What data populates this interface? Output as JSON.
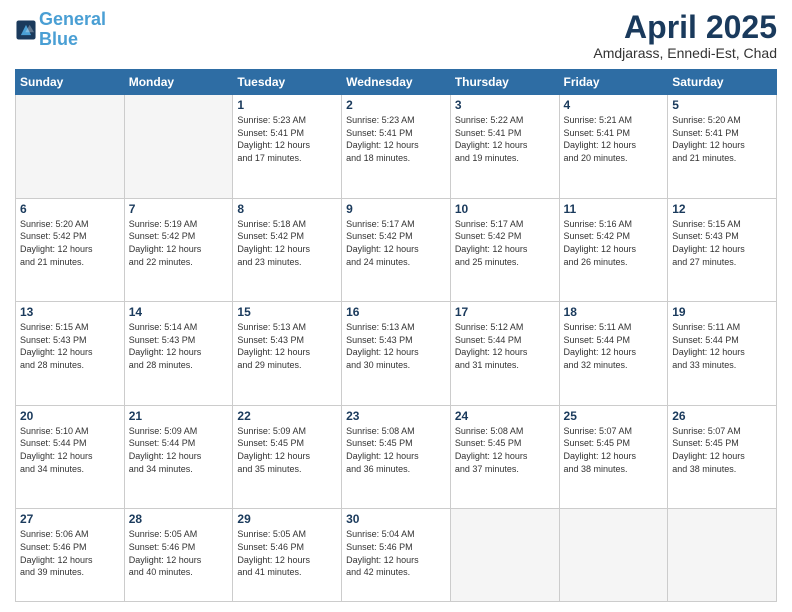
{
  "logo": {
    "line1": "General",
    "line2": "Blue"
  },
  "title": "April 2025",
  "location": "Amdjarass, Ennedi-Est, Chad",
  "days_header": [
    "Sunday",
    "Monday",
    "Tuesday",
    "Wednesday",
    "Thursday",
    "Friday",
    "Saturday"
  ],
  "weeks": [
    [
      {
        "day": "",
        "info": ""
      },
      {
        "day": "",
        "info": ""
      },
      {
        "day": "1",
        "info": "Sunrise: 5:23 AM\nSunset: 5:41 PM\nDaylight: 12 hours\nand 17 minutes."
      },
      {
        "day": "2",
        "info": "Sunrise: 5:23 AM\nSunset: 5:41 PM\nDaylight: 12 hours\nand 18 minutes."
      },
      {
        "day": "3",
        "info": "Sunrise: 5:22 AM\nSunset: 5:41 PM\nDaylight: 12 hours\nand 19 minutes."
      },
      {
        "day": "4",
        "info": "Sunrise: 5:21 AM\nSunset: 5:41 PM\nDaylight: 12 hours\nand 20 minutes."
      },
      {
        "day": "5",
        "info": "Sunrise: 5:20 AM\nSunset: 5:41 PM\nDaylight: 12 hours\nand 21 minutes."
      }
    ],
    [
      {
        "day": "6",
        "info": "Sunrise: 5:20 AM\nSunset: 5:42 PM\nDaylight: 12 hours\nand 21 minutes."
      },
      {
        "day": "7",
        "info": "Sunrise: 5:19 AM\nSunset: 5:42 PM\nDaylight: 12 hours\nand 22 minutes."
      },
      {
        "day": "8",
        "info": "Sunrise: 5:18 AM\nSunset: 5:42 PM\nDaylight: 12 hours\nand 23 minutes."
      },
      {
        "day": "9",
        "info": "Sunrise: 5:17 AM\nSunset: 5:42 PM\nDaylight: 12 hours\nand 24 minutes."
      },
      {
        "day": "10",
        "info": "Sunrise: 5:17 AM\nSunset: 5:42 PM\nDaylight: 12 hours\nand 25 minutes."
      },
      {
        "day": "11",
        "info": "Sunrise: 5:16 AM\nSunset: 5:42 PM\nDaylight: 12 hours\nand 26 minutes."
      },
      {
        "day": "12",
        "info": "Sunrise: 5:15 AM\nSunset: 5:43 PM\nDaylight: 12 hours\nand 27 minutes."
      }
    ],
    [
      {
        "day": "13",
        "info": "Sunrise: 5:15 AM\nSunset: 5:43 PM\nDaylight: 12 hours\nand 28 minutes."
      },
      {
        "day": "14",
        "info": "Sunrise: 5:14 AM\nSunset: 5:43 PM\nDaylight: 12 hours\nand 28 minutes."
      },
      {
        "day": "15",
        "info": "Sunrise: 5:13 AM\nSunset: 5:43 PM\nDaylight: 12 hours\nand 29 minutes."
      },
      {
        "day": "16",
        "info": "Sunrise: 5:13 AM\nSunset: 5:43 PM\nDaylight: 12 hours\nand 30 minutes."
      },
      {
        "day": "17",
        "info": "Sunrise: 5:12 AM\nSunset: 5:44 PM\nDaylight: 12 hours\nand 31 minutes."
      },
      {
        "day": "18",
        "info": "Sunrise: 5:11 AM\nSunset: 5:44 PM\nDaylight: 12 hours\nand 32 minutes."
      },
      {
        "day": "19",
        "info": "Sunrise: 5:11 AM\nSunset: 5:44 PM\nDaylight: 12 hours\nand 33 minutes."
      }
    ],
    [
      {
        "day": "20",
        "info": "Sunrise: 5:10 AM\nSunset: 5:44 PM\nDaylight: 12 hours\nand 34 minutes."
      },
      {
        "day": "21",
        "info": "Sunrise: 5:09 AM\nSunset: 5:44 PM\nDaylight: 12 hours\nand 34 minutes."
      },
      {
        "day": "22",
        "info": "Sunrise: 5:09 AM\nSunset: 5:45 PM\nDaylight: 12 hours\nand 35 minutes."
      },
      {
        "day": "23",
        "info": "Sunrise: 5:08 AM\nSunset: 5:45 PM\nDaylight: 12 hours\nand 36 minutes."
      },
      {
        "day": "24",
        "info": "Sunrise: 5:08 AM\nSunset: 5:45 PM\nDaylight: 12 hours\nand 37 minutes."
      },
      {
        "day": "25",
        "info": "Sunrise: 5:07 AM\nSunset: 5:45 PM\nDaylight: 12 hours\nand 38 minutes."
      },
      {
        "day": "26",
        "info": "Sunrise: 5:07 AM\nSunset: 5:45 PM\nDaylight: 12 hours\nand 38 minutes."
      }
    ],
    [
      {
        "day": "27",
        "info": "Sunrise: 5:06 AM\nSunset: 5:46 PM\nDaylight: 12 hours\nand 39 minutes."
      },
      {
        "day": "28",
        "info": "Sunrise: 5:05 AM\nSunset: 5:46 PM\nDaylight: 12 hours\nand 40 minutes."
      },
      {
        "day": "29",
        "info": "Sunrise: 5:05 AM\nSunset: 5:46 PM\nDaylight: 12 hours\nand 41 minutes."
      },
      {
        "day": "30",
        "info": "Sunrise: 5:04 AM\nSunset: 5:46 PM\nDaylight: 12 hours\nand 42 minutes."
      },
      {
        "day": "",
        "info": ""
      },
      {
        "day": "",
        "info": ""
      },
      {
        "day": "",
        "info": ""
      }
    ]
  ]
}
